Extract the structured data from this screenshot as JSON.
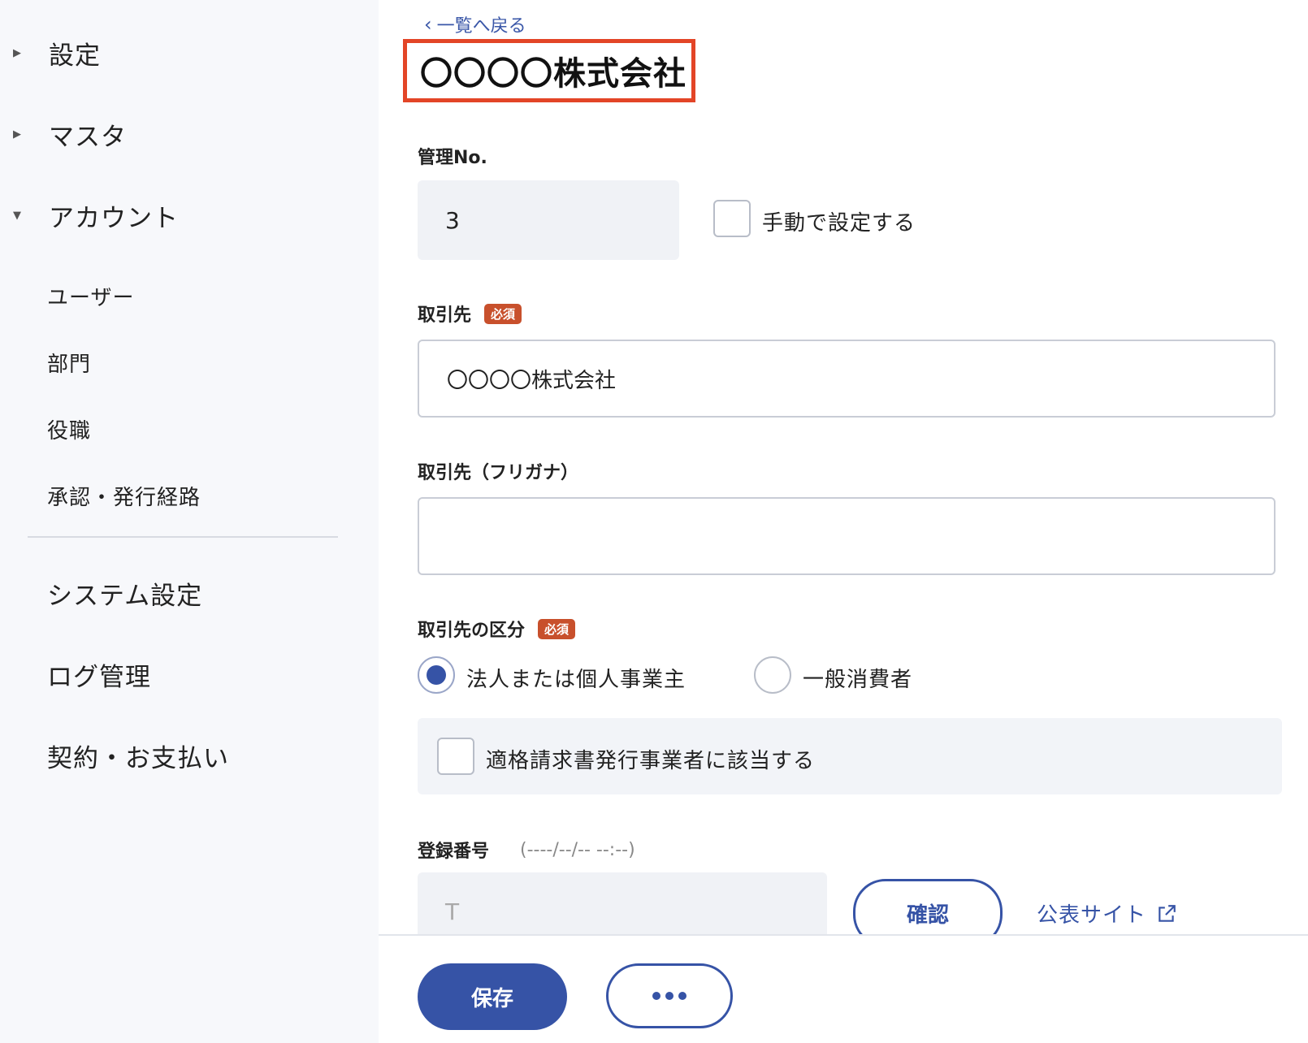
{
  "sidebar": {
    "groups": [
      {
        "label": "設定",
        "icon": "caret-right-icon"
      },
      {
        "label": "マスタ",
        "icon": "caret-right-icon"
      },
      {
        "label": "アカウント",
        "icon": "caret-down-icon"
      }
    ],
    "account_items": [
      "ユーザー",
      "部門",
      "役職",
      "承認・発行経路"
    ],
    "bottom_items": [
      "システム設定",
      "ログ管理",
      "契約・お支払い"
    ]
  },
  "header": {
    "back_label": "一覧へ戻る",
    "title": "〇〇〇〇株式会社"
  },
  "form": {
    "management_no": {
      "label": "管理No.",
      "value": "3",
      "manual_checkbox_label": "手動で設定する",
      "manual_checked": false
    },
    "partner": {
      "label": "取引先",
      "required_badge": "必須",
      "value": "〇〇〇〇株式会社"
    },
    "partner_kana": {
      "label": "取引先（フリガナ）",
      "value": ""
    },
    "partner_type": {
      "label": "取引先の区分",
      "required_badge": "必須",
      "options": [
        "法人または個人事業主",
        "一般消費者"
      ],
      "selected": "法人または個人事業主"
    },
    "qualified_invoice": {
      "label": "適格請求書発行事業者に該当する",
      "checked": false
    },
    "registration_no": {
      "label": "登録番号",
      "hint": "(----/--/-- --:--)",
      "placeholder": "T",
      "confirm_button": "確認",
      "public_site_link": "公表サイト"
    }
  },
  "footer": {
    "save_button": "保存",
    "more_button": "•••"
  },
  "colors": {
    "accent": "#3653a6",
    "highlight_border": "#e34527",
    "required_badge": "#c8502c"
  }
}
